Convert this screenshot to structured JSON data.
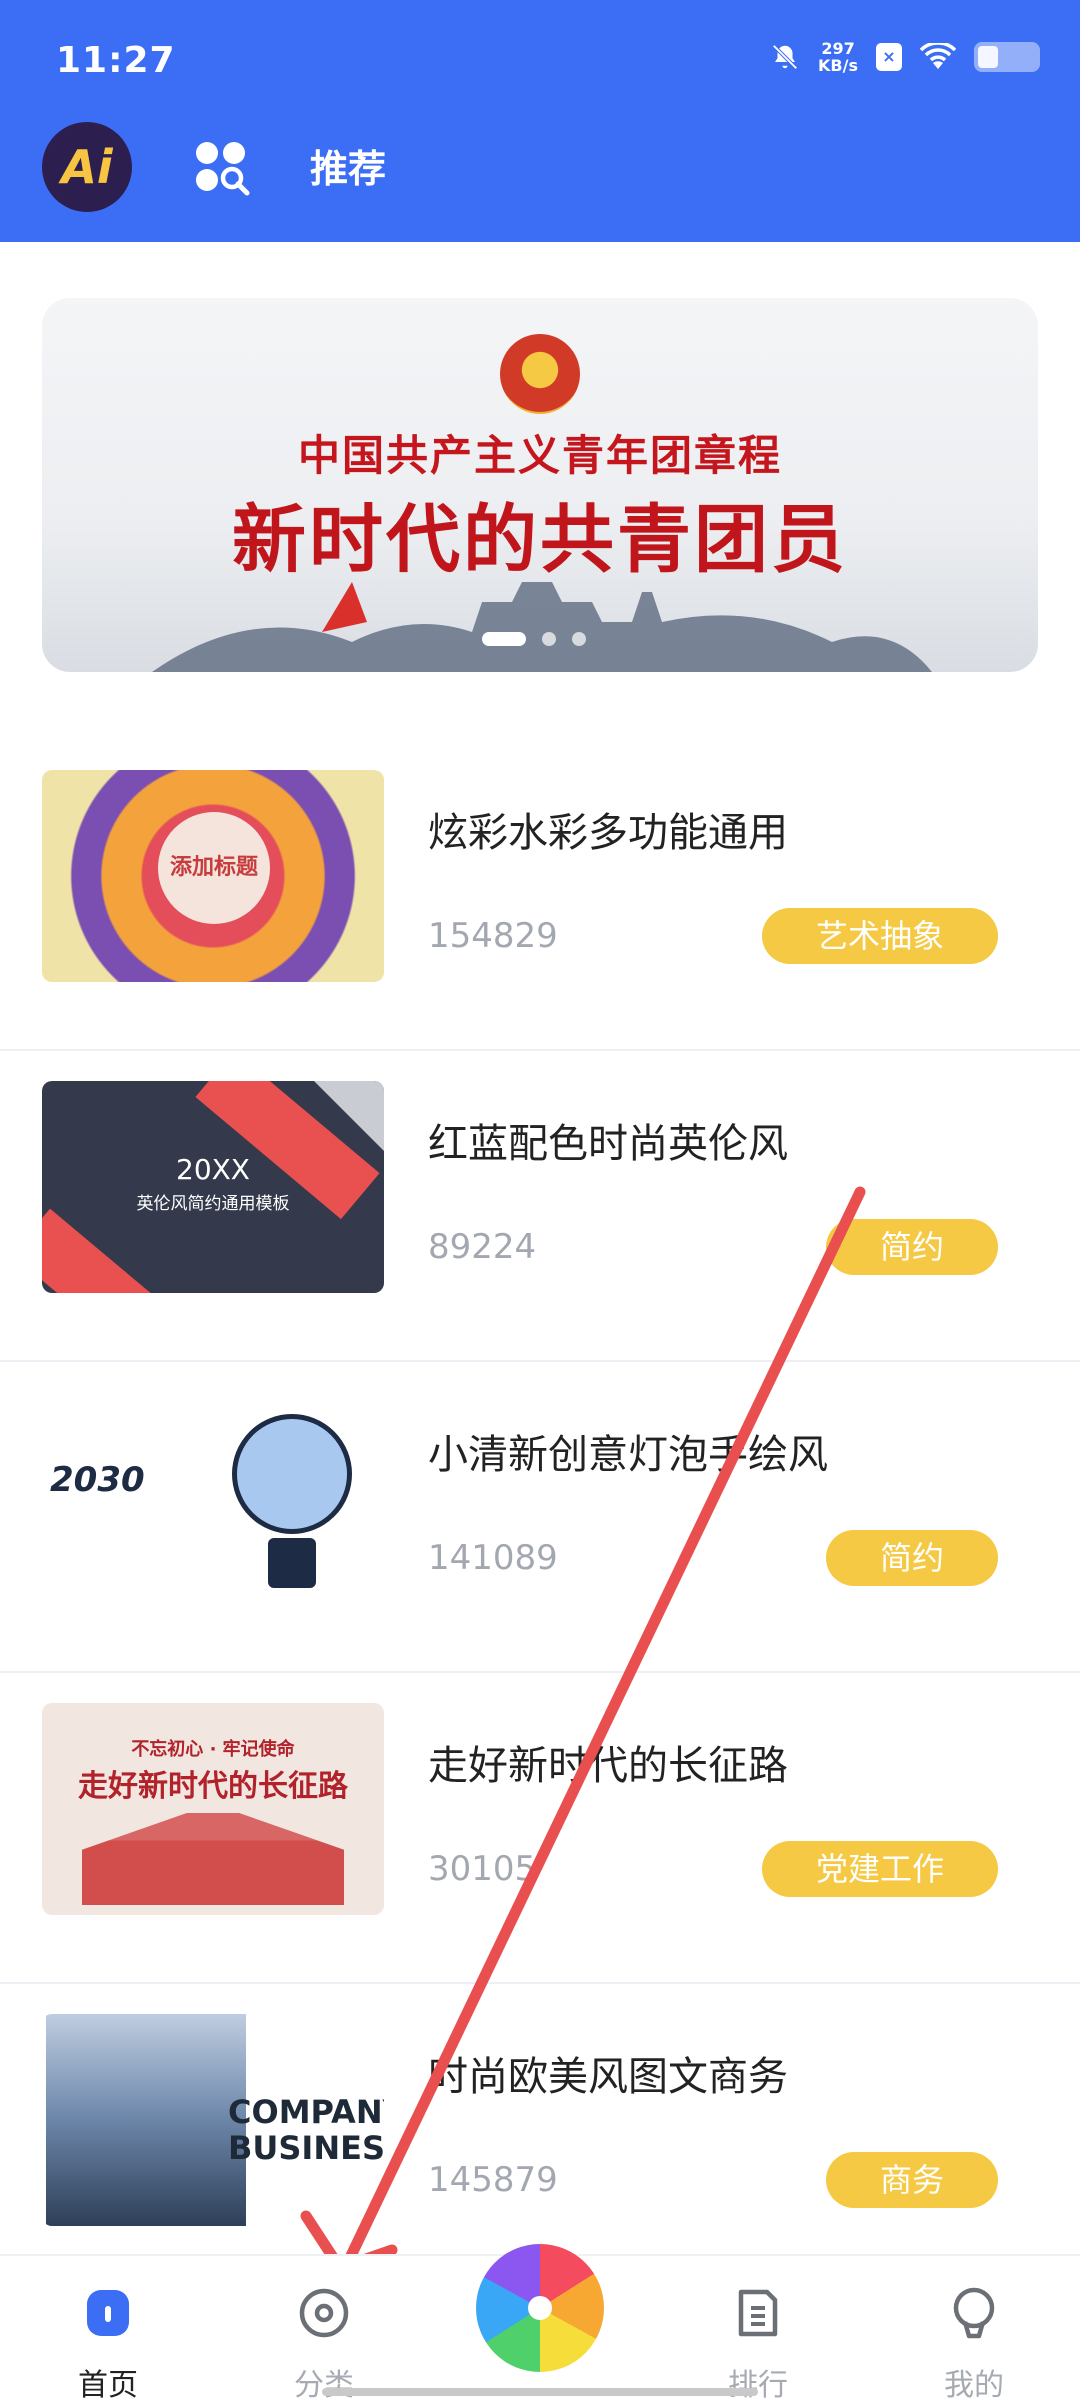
{
  "status_bar": {
    "time": "11:27",
    "speed_value": "297",
    "speed_unit": "KB/s"
  },
  "header": {
    "logo_text": "Ai",
    "title": "推荐"
  },
  "banner": {
    "line1": "中国共产主义青年团章程",
    "line2": "新时代的共青团员",
    "page_count": 3,
    "active_page": 1
  },
  "items": [
    {
      "title": "炫彩水彩多功能通用",
      "count": "154829",
      "tag": "艺术抽象",
      "thumb_text": "添加标题"
    },
    {
      "title": "红蓝配色时尚英伦风",
      "count": "89224",
      "tag": "简约",
      "thumb_title": "20XX",
      "thumb_subtitle": "英伦风简约通用模板"
    },
    {
      "title": "小清新创意灯泡手绘风",
      "count": "141089",
      "tag": "简约",
      "thumb_title": "2030"
    },
    {
      "title": "走好新时代的长征路",
      "count": "30105",
      "tag": "党建工作",
      "thumb_line1": "不忘初心 · 牢记使命",
      "thumb_line2": "走好新时代的长征路"
    },
    {
      "title": "时尚欧美风图文商务",
      "count": "145879",
      "tag": "商务",
      "thumb_line1": "COMPANY",
      "thumb_line2": "BUSINESS"
    }
  ],
  "bottom_nav": [
    {
      "label": "首页",
      "icon": "home-icon",
      "active": true
    },
    {
      "label": "分类",
      "icon": "category-icon",
      "active": false
    },
    {
      "label": "",
      "icon": "pinwheel-icon",
      "active": false
    },
    {
      "label": "排行",
      "icon": "ranking-icon",
      "active": false
    },
    {
      "label": "我的",
      "icon": "profile-icon",
      "active": false
    }
  ],
  "colors": {
    "header": "#3b6ef5",
    "tag": "#f6c944",
    "annotation_arrow": "#ea4f4f"
  }
}
